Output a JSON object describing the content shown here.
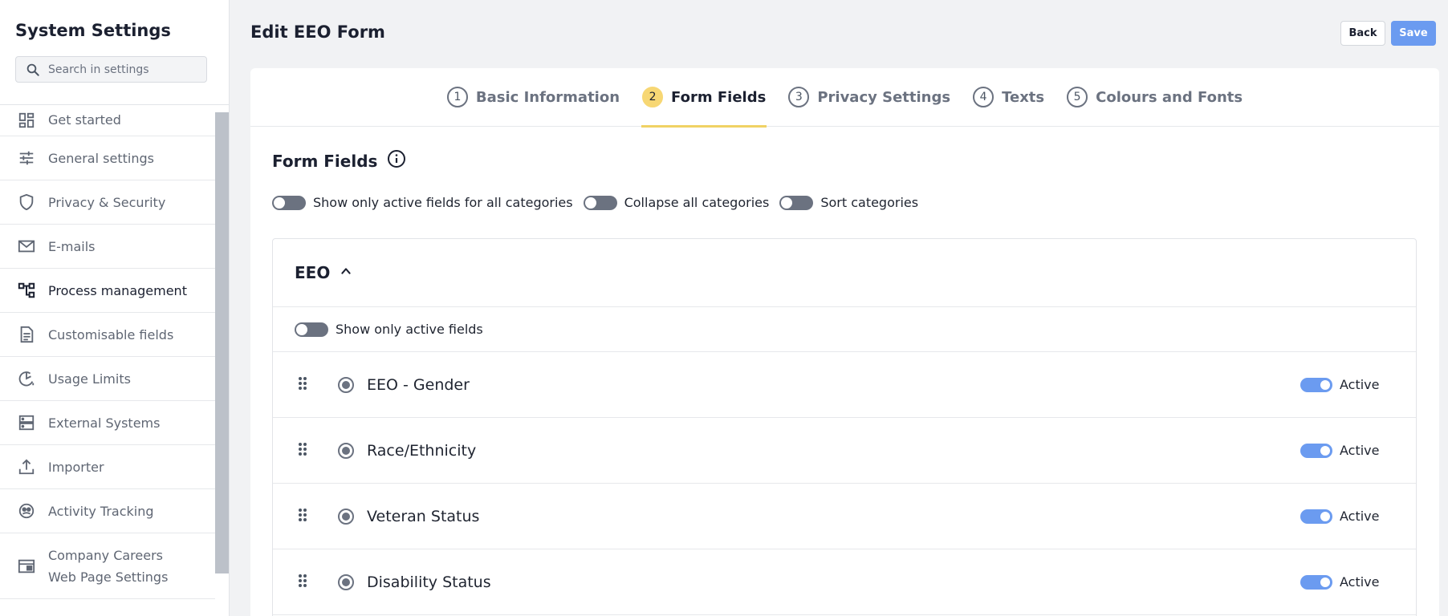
{
  "sidebar": {
    "title": "System Settings",
    "search_placeholder": "Search in settings",
    "items": [
      {
        "label": "Get started",
        "icon": "dashboard-icon"
      },
      {
        "label": "General settings",
        "icon": "sliders-icon"
      },
      {
        "label": "Privacy & Security",
        "icon": "shield-icon"
      },
      {
        "label": "E-mails",
        "icon": "mail-icon"
      },
      {
        "label": "Process management",
        "icon": "process-icon",
        "active": true
      },
      {
        "label": "Customisable fields",
        "icon": "document-icon"
      },
      {
        "label": "Usage Limits",
        "icon": "usage-icon"
      },
      {
        "label": "External Systems",
        "icon": "server-icon"
      },
      {
        "label": "Importer",
        "icon": "upload-icon"
      },
      {
        "label": "Activity Tracking",
        "icon": "activity-icon"
      },
      {
        "label": "Company Careers Web Page Settings",
        "icon": "webpage-icon"
      }
    ]
  },
  "header": {
    "title": "Edit EEO Form",
    "back_label": "Back",
    "save_label": "Save"
  },
  "steps": [
    {
      "num": "1",
      "label": "Basic Information"
    },
    {
      "num": "2",
      "label": "Form Fields",
      "active": true
    },
    {
      "num": "3",
      "label": "Privacy Settings"
    },
    {
      "num": "4",
      "label": "Texts"
    },
    {
      "num": "5",
      "label": "Colours and Fonts"
    }
  ],
  "section": {
    "title": "Form Fields",
    "filters": [
      "Show only active fields for all categories",
      "Collapse all categories",
      "Sort categories"
    ]
  },
  "category": {
    "title": "EEO",
    "filter_label": "Show only active fields",
    "fields": [
      {
        "label": "EEO - Gender",
        "status": "Active"
      },
      {
        "label": "Race/Ethnicity",
        "status": "Active"
      },
      {
        "label": "Veteran Status",
        "status": "Active"
      },
      {
        "label": "Disability Status",
        "status": "Active"
      }
    ]
  },
  "colors": {
    "accent": "#6b9bf0",
    "step_active": "#f7d774",
    "toggle_off": "#6b7280"
  }
}
